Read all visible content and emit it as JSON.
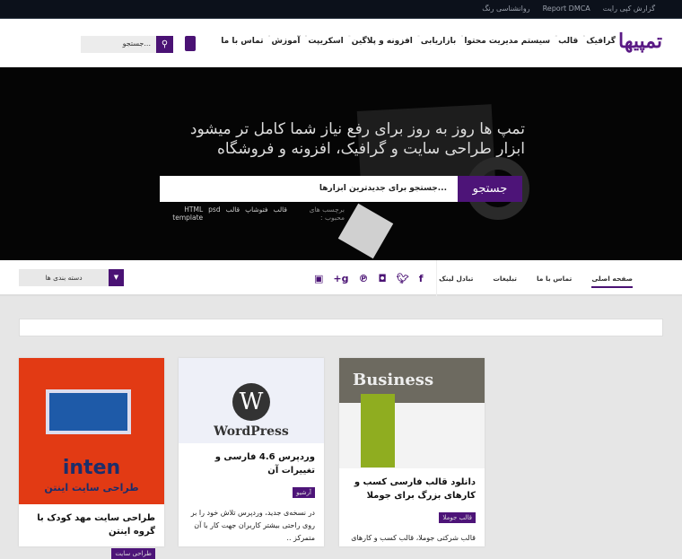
{
  "topbar": {
    "links": [
      "گزارش کپی رایت",
      "Report DMCA",
      "روانشناسی رنگ"
    ]
  },
  "header": {
    "logo": "تمپیها",
    "menu": [
      "گرافیک",
      "قالب",
      "سیستم مدیریت محتوا",
      "بازاریابی",
      "افزونه و پلاگین",
      "اسکریپت",
      "آموزش",
      "تماس با ما"
    ],
    "search_placeholder": "جستجو..."
  },
  "hero": {
    "line1": "تمپ ها روز به روز برای رفع نیاز شما کامل تر میشود",
    "line2": "ابزار طراحی سایت و گرافیک، افزونه و فروشگاه",
    "search_placeholder": "جستجو برای جدیدترین ابزارها...",
    "search_button": "جستجو",
    "tags_label": "برچسب های محبوب :",
    "tags": [
      "قالب",
      "فتوشاپ",
      "قالب",
      "psd",
      "HTML template"
    ]
  },
  "nav": {
    "links": [
      "صفحه اصلی",
      "تماس با ما",
      "تبلیغات",
      "تبادل لینک"
    ],
    "social": [
      "facebook",
      "twitter",
      "instagram",
      "pinterest",
      "google-plus",
      "youtube"
    ],
    "category": "دسته بندی ها"
  },
  "cards": [
    {
      "title": "طراحی سایت مهد کودک با گروه اینتن",
      "badge": "طراحی سایت",
      "img_text": "inten",
      "img_sub": "طراحی سایت اینتن"
    },
    {
      "title": "وردپرس 4.6 فارسی و تغییرات آن",
      "badge": "آرشیو",
      "excerpt": "در نسخه‌ی جدید، وردپرس تلاش خود را بر روی راحتی بیشتر کاربران جهت کار با آن متمرکز ..",
      "img_text": "WordPress"
    },
    {
      "title": "دانلود قالب فارسی کسب و کارهای بزرگ برای جوملا",
      "badge": "قالب جوملا",
      "excerpt": "قالب شرکتی جوملا، قالب کسب و کارهای",
      "img_text": "Business"
    }
  ]
}
